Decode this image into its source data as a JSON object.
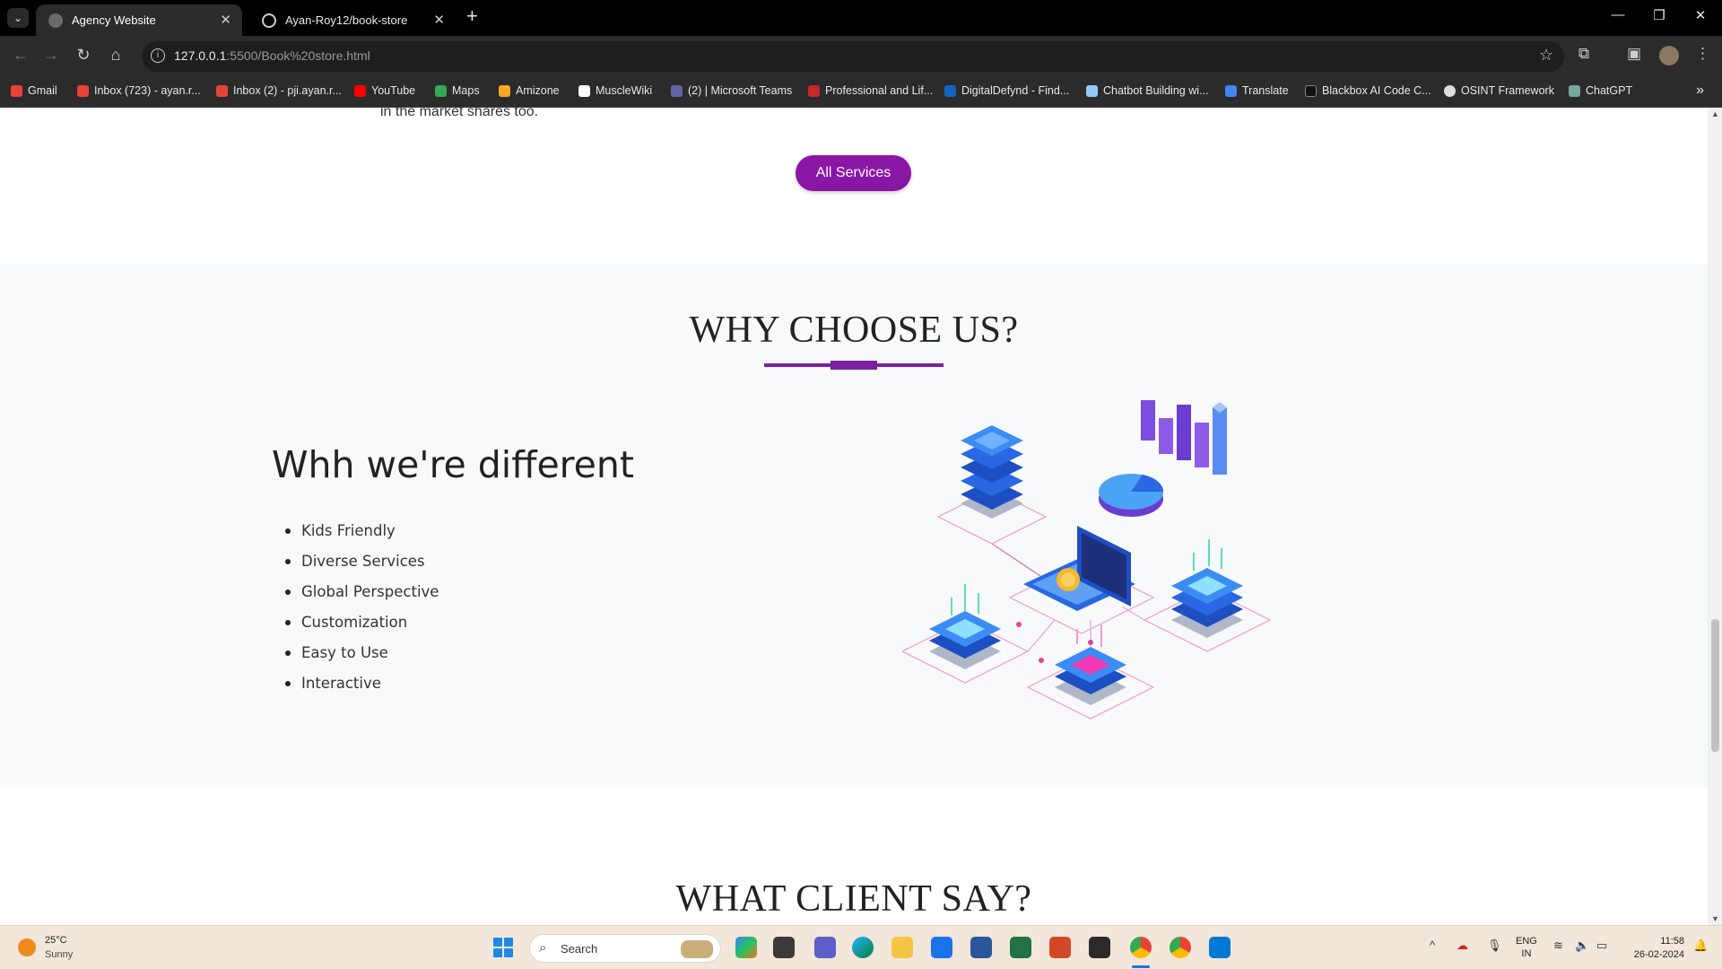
{
  "browser": {
    "tabs": [
      {
        "title": "Agency Website",
        "active": true
      },
      {
        "title": "Ayan-Roy12/book-store",
        "active": false
      }
    ],
    "url_host": "127.0.0.1",
    "url_rest": ":5500/Book%20store.html",
    "bookmarks": [
      {
        "label": "Gmail",
        "color": "#ea4335"
      },
      {
        "label": "Inbox (723) - ayan.r...",
        "color": "#ea4335"
      },
      {
        "label": "Inbox (2) - pji.ayan.r...",
        "color": "#ea4335"
      },
      {
        "label": "YouTube",
        "color": "#ff0000"
      },
      {
        "label": "Maps",
        "color": "#34a853"
      },
      {
        "label": "Amizone",
        "color": "#f9a825"
      },
      {
        "label": "MuscleWiki",
        "color": "#ffffff"
      },
      {
        "label": "(2) | Microsoft Teams",
        "color": "#6264a7"
      },
      {
        "label": "Professional and Lif...",
        "color": "#c62828"
      },
      {
        "label": "DigitalDefynd - Find...",
        "color": "#1565c0"
      },
      {
        "label": "Chatbot Building wi...",
        "color": "#90caf9"
      },
      {
        "label": "Translate",
        "color": "#4285f4"
      },
      {
        "label": "Blackbox AI Code C...",
        "color": "#111111"
      },
      {
        "label": "OSINT Framework",
        "color": "#dddddd"
      },
      {
        "label": "ChatGPT",
        "color": "#74aa9c"
      }
    ]
  },
  "page": {
    "prev_text": "in the market shares too.",
    "all_services_label": "All Services",
    "why_title": "WHY CHOOSE US?",
    "diff_heading": "Whh we're different",
    "features": [
      "Kids Friendly",
      "Diverse Services",
      "Global Perspective",
      "Customization",
      "Easy to Use",
      "Interactive"
    ],
    "client_title": "WHAT CLIENT SAY?",
    "accent_color": "#7b1fa2"
  },
  "taskbar": {
    "weather_temp": "25°C",
    "weather_desc": "Sunny",
    "search_label": "Search",
    "lang_line1": "ENG",
    "lang_line2": "IN",
    "time": "11:58",
    "date": "26-02-2024"
  }
}
